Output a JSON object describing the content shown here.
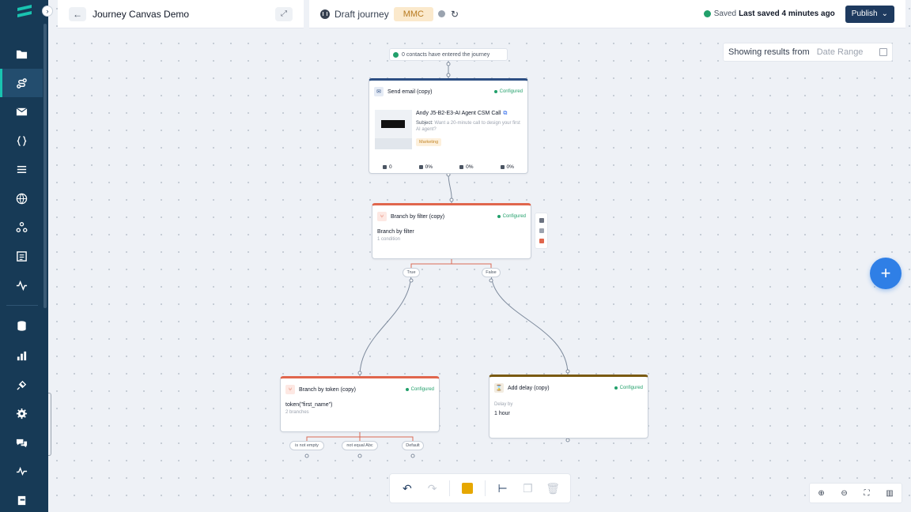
{
  "header": {
    "journey_title": "Journey Canvas Demo",
    "status_label": "Draft journey",
    "tag": "MMC",
    "saved_label": "Saved",
    "saved_time": "Last saved 4 minutes ago",
    "publish_label": "Publish"
  },
  "results": {
    "label": "Showing results from",
    "range_placeholder": "Date Range"
  },
  "entry": {
    "text": "0 contacts have entered the journey"
  },
  "nodes": {
    "send_email": {
      "title": "Send email (copy)",
      "status": "Configured",
      "email_name": "Andy J5-B2-E3-AI Agent CSM Call",
      "subject_label": "Subject:",
      "subject_text": "Want a 20-minute call to design your first AI agent?",
      "tag": "Marketing",
      "stats": [
        "0",
        "0%",
        "0%",
        "0%"
      ]
    },
    "branch_filter": {
      "title": "Branch by filter (copy)",
      "status": "Configured",
      "main": "Branch by filter",
      "sub": "1 condition",
      "branches": [
        "True",
        "False"
      ]
    },
    "branch_token": {
      "title": "Branch by token (copy)",
      "status": "Configured",
      "main": "token(\"first_name\")",
      "sub": "2 branches",
      "branches": [
        "is not empty",
        "not equal Abc",
        "Default"
      ]
    },
    "delay": {
      "title": "Add delay (copy)",
      "status": "Configured",
      "label": "Delay by",
      "value": "1 hour"
    }
  },
  "colors": {
    "sidebar": "#173a56",
    "accent": "#2f7fe6",
    "configured": "#22a06b",
    "branch": "#e0664d",
    "email": "#2d4f83",
    "delay": "#7a5a12"
  }
}
